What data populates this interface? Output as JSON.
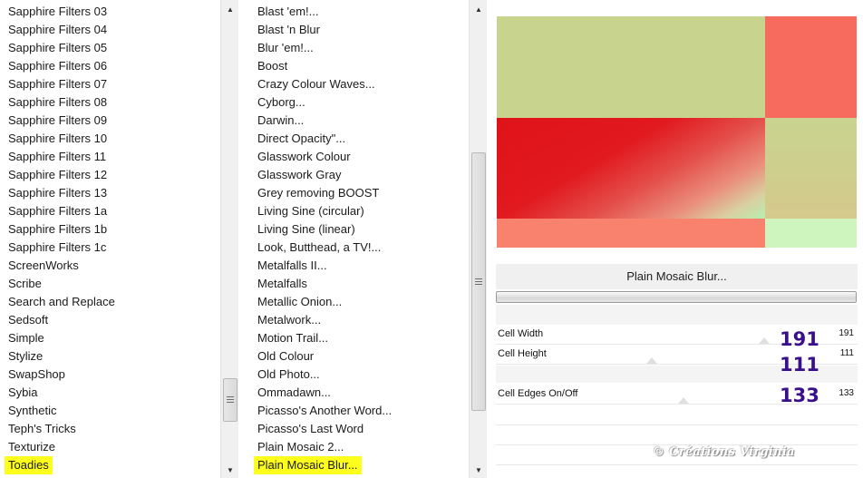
{
  "categories": {
    "items": [
      "Sapphire Filters 03",
      "Sapphire Filters 04",
      "Sapphire Filters 05",
      "Sapphire Filters 06",
      "Sapphire Filters 07",
      "Sapphire Filters 08",
      "Sapphire Filters 09",
      "Sapphire Filters 10",
      "Sapphire Filters 11",
      "Sapphire Filters 12",
      "Sapphire Filters 13",
      "Sapphire Filters 1a",
      "Sapphire Filters 1b",
      "Sapphire Filters 1c",
      "ScreenWorks",
      "Scribe",
      "Search and Replace",
      "Sedsoft",
      "Simple",
      "Stylize",
      "SwapShop",
      "Sybia",
      "Synthetic",
      "Teph's Tricks",
      "Texturize",
      "Toadies"
    ],
    "selected": "Toadies"
  },
  "filters": {
    "items": [
      "Blast 'em!...",
      "Blast 'n Blur",
      "Blur 'em!...",
      "Boost",
      "Crazy Colour Waves...",
      "Cyborg...",
      "Darwin...",
      "Direct Opacity\"...",
      "Glasswork Colour",
      "Glasswork Gray",
      "Grey removing BOOST",
      "Living Sine (circular)",
      "Living Sine (linear)",
      "Look, Butthead, a TV!...",
      "Metalfalls II...",
      "Metalfalls",
      "Metallic Onion...",
      "Metalwork...",
      "Motion Trail...",
      "Old Colour",
      "Old Photo...",
      "Ommadawn...",
      "Picasso's Another Word...",
      "Picasso's Last Word",
      "Plain Mosaic 2...",
      "Plain Mosaic Blur..."
    ],
    "selected": "Plain Mosaic Blur..."
  },
  "dialog": {
    "title": "Plain Mosaic Blur...",
    "controls": [
      {
        "label": "Cell Width",
        "value": "191",
        "annotation": "191"
      },
      {
        "label": "Cell Height",
        "value": "111",
        "annotation": "111"
      },
      {
        "label": "Cell Edges On/Off",
        "value": "133",
        "annotation": "133"
      }
    ]
  },
  "scrollbar_icons": {
    "up": "arrow-up-icon",
    "down": "arrow-down-icon",
    "grip": "grip-icon"
  },
  "colors": {
    "highlight": "#ffff1e",
    "annotation": "#3a0f8a",
    "preview": [
      "#c8d48d",
      "#f76b5e",
      "#df1219",
      "#c8d48f",
      "#f9826e",
      "#cdf5bd"
    ]
  },
  "watermark": "© Créations Virginia"
}
